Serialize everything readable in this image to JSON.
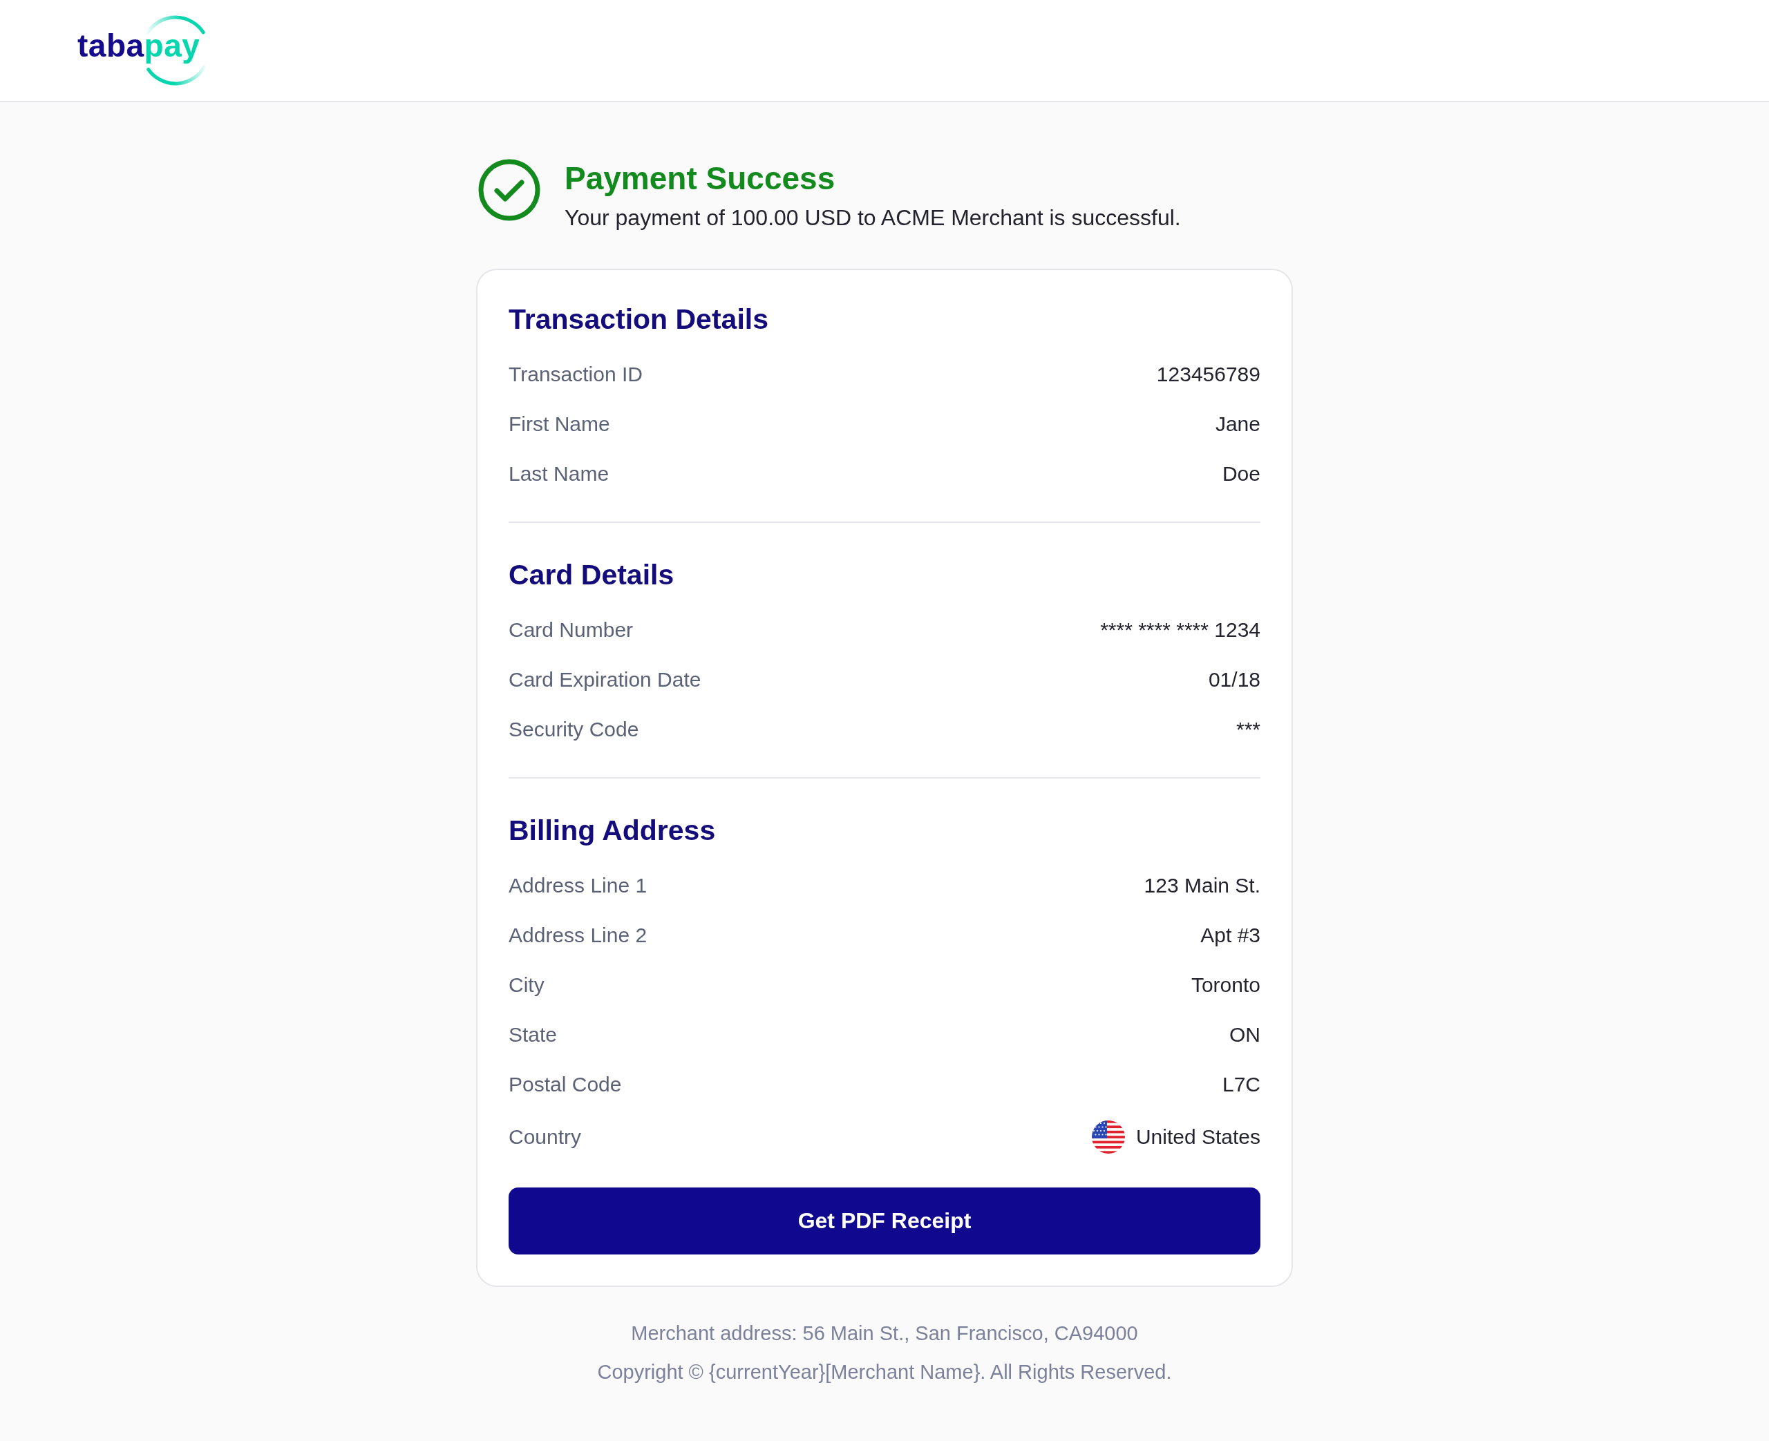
{
  "header": {
    "logo": {
      "parts": [
        {
          "text": "taba",
          "color": "#140c8c"
        },
        {
          "text": "pay",
          "color": "#05d6ae"
        }
      ]
    }
  },
  "status": {
    "title": "Payment Success",
    "message": "Your payment of 100.00 USD to ACME Merchant is successful."
  },
  "sections": [
    {
      "title": "Transaction Details",
      "rows": [
        {
          "kind": "plain",
          "label": "Transaction ID",
          "value": "123456789"
        },
        {
          "kind": "plain",
          "label": "First Name",
          "value": "Jane"
        },
        {
          "kind": "plain",
          "label": "Last Name",
          "value": "Doe"
        }
      ]
    },
    {
      "title": "Card Details",
      "rows": [
        {
          "kind": "plain",
          "label": "Card Number",
          "value": "**** **** **** 1234"
        },
        {
          "kind": "plain",
          "label": "Card Expiration Date",
          "value": "01/18"
        },
        {
          "kind": "plain",
          "label": "Security Code",
          "value": "***"
        }
      ]
    },
    {
      "title": "Billing Address",
      "rows": [
        {
          "kind": "plain",
          "label": "Address Line 1",
          "value": "123 Main St."
        },
        {
          "kind": "plain",
          "label": "Address Line 2",
          "value": "Apt #3"
        },
        {
          "kind": "plain",
          "label": "City",
          "value": "Toronto"
        },
        {
          "kind": "plain",
          "label": "State",
          "value": "ON"
        },
        {
          "kind": "plain",
          "label": "Postal Code",
          "value": "L7C"
        },
        {
          "kind": "flag",
          "label": "Country",
          "value": "United States"
        }
      ]
    }
  ],
  "receipt_button": {
    "label": "Get PDF Receipt"
  },
  "footer": {
    "lines": [
      "Merchant address: 56 Main St., San Francisco, CA94000",
      "Copyright © {currentYear}[Merchant Name}. All Rights Reserved."
    ]
  }
}
